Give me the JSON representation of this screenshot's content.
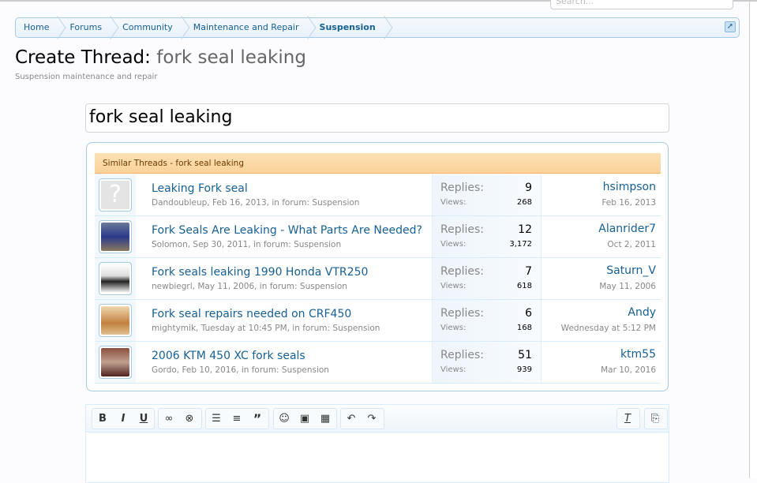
{
  "search": {
    "placeholder": "Search..."
  },
  "breadcrumb": [
    "Home",
    "Forums",
    "Community",
    "Maintenance and Repair",
    "Suspension"
  ],
  "page": {
    "title_prefix": "Create Thread:",
    "title_name": "fork seal leaking",
    "subtitle": "Suspension maintenance and repair"
  },
  "form": {
    "title_value": "fork seal leaking"
  },
  "similar": {
    "header": "Similar Threads - fork seal leaking",
    "replies_label": "Replies:",
    "views_label": "Views:",
    "threads": [
      {
        "title": "Leaking Fork seal",
        "meta": "Dandoubleup, Feb 16, 2013, in forum: Suspension",
        "replies": "9",
        "views": "268",
        "last_user": "hsimpson",
        "last_date": "Feb 16, 2013",
        "avatar": "placeholder"
      },
      {
        "title": "Fork Seals Are Leaking - What Parts Are Needed?",
        "meta": "Solomon, Sep 30, 2011, in forum: Suspension",
        "replies": "12",
        "views": "3,172",
        "last_user": "Alanrider7",
        "last_date": "Oct 2, 2011",
        "avatar": "motorcycle-photo"
      },
      {
        "title": "Fork seals leaking 1990 Honda VTR250",
        "meta": "newbiegrl, May 11, 2006, in forum: Suspension",
        "replies": "7",
        "views": "618",
        "last_user": "Saturn_V",
        "last_date": "May 11, 2006",
        "avatar": "drawing"
      },
      {
        "title": "Fork seal repairs needed on CRF450",
        "meta": "mightymik, Tuesday at 10:45 PM, in forum: Suspension",
        "replies": "6",
        "views": "168",
        "last_user": "Andy",
        "last_date": "Wednesday at 5:12 PM",
        "avatar": "dirtbike-photo"
      },
      {
        "title": "2006 KTM 450 XC fork seals",
        "meta": "Gordo, Feb 10, 2016, in forum: Suspension",
        "replies": "51",
        "views": "939",
        "last_user": "ktm55",
        "last_date": "Mar 10, 2016",
        "avatar": "garage-photo"
      }
    ]
  },
  "toolbar": {
    "bold": "B",
    "italic": "I",
    "underline": "U"
  },
  "colors": {
    "link": "#176093",
    "header_bg": "#fbd9a5",
    "border": "#a5cae4"
  }
}
